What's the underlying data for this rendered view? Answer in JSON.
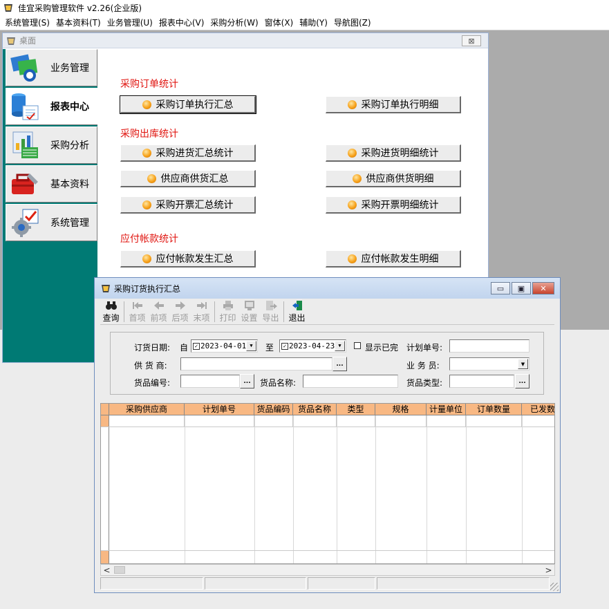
{
  "app": {
    "title": "佳宜采购管理软件 v2.26(企业版)"
  },
  "menu": [
    "系统管理(S)",
    "基本资料(T)",
    "业务管理(U)",
    "报表中心(V)",
    "采购分析(W)",
    "窗体(X)",
    "辅助(Y)",
    "导航图(Z)"
  ],
  "desktop": {
    "title": "桌面",
    "close_label": "⊠",
    "nav": [
      {
        "label": "业务管理",
        "icon": "business-icon"
      },
      {
        "label": "报表中心",
        "icon": "report-icon",
        "active": true
      },
      {
        "label": "采购分析",
        "icon": "analysis-icon"
      },
      {
        "label": "基本资料",
        "icon": "toolbox-icon"
      },
      {
        "label": "系统管理",
        "icon": "system-gear-icon"
      }
    ],
    "sections": {
      "order": "采购订单统计",
      "inbound": "采购出库统计",
      "payable": "应付帐款统计"
    },
    "buttons": {
      "order_summary": "采购订单执行汇总",
      "order_detail": "采购订单执行明细",
      "inbound_summary": "采购进货汇总统计",
      "inbound_detail": "采购进货明细统计",
      "supplier_summary": "供应商供货汇总",
      "supplier_detail": "供应商供货明细",
      "invoice_summary": "采购开票汇总统计",
      "invoice_detail": "采购开票明细统计",
      "payable_summary": "应付帐款发生汇总",
      "payable_detail": "应付帐款发生明细"
    }
  },
  "child": {
    "title": "采购订货执行汇总",
    "caption_min": "▭",
    "caption_max": "▣",
    "caption_close": "✕",
    "toolbar": [
      {
        "label": "查询",
        "icon": "binoculars-icon",
        "enabled": true
      },
      {
        "label": "首项",
        "icon": "first-arrow-icon",
        "enabled": false
      },
      {
        "label": "前项",
        "icon": "prev-arrow-icon",
        "enabled": false
      },
      {
        "label": "后项",
        "icon": "next-arrow-icon",
        "enabled": false
      },
      {
        "label": "末项",
        "icon": "last-arrow-icon",
        "enabled": false
      },
      {
        "label": "打印",
        "icon": "printer-icon",
        "enabled": false
      },
      {
        "label": "设置",
        "icon": "settings-icon",
        "enabled": false
      },
      {
        "label": "导出",
        "icon": "export-icon",
        "enabled": false
      },
      {
        "label": "退出",
        "icon": "exit-door-icon",
        "enabled": true
      }
    ],
    "filters": {
      "order_date_label": "订货日期:",
      "from_label": "自",
      "from_date": "2023-04-01",
      "to_label": "至",
      "to_date": "2023-04-23",
      "show_done_label": "显示已完",
      "plan_no_label": "计划单号:",
      "supplier_label": "供 货 商:",
      "salesman_label": "业 务 员:",
      "item_code_label": "货品编号:",
      "item_name_label": "货品名称:",
      "item_type_label": "货品类型:",
      "ellipsis": "..."
    },
    "grid": {
      "columns": [
        "采购供应商",
        "计划单号",
        "货品编码",
        "货品名称",
        "类型",
        "规格",
        "计量单位",
        "订单数量",
        "已发数"
      ]
    },
    "scroll": {
      "left": "<",
      "right": ">"
    }
  }
}
